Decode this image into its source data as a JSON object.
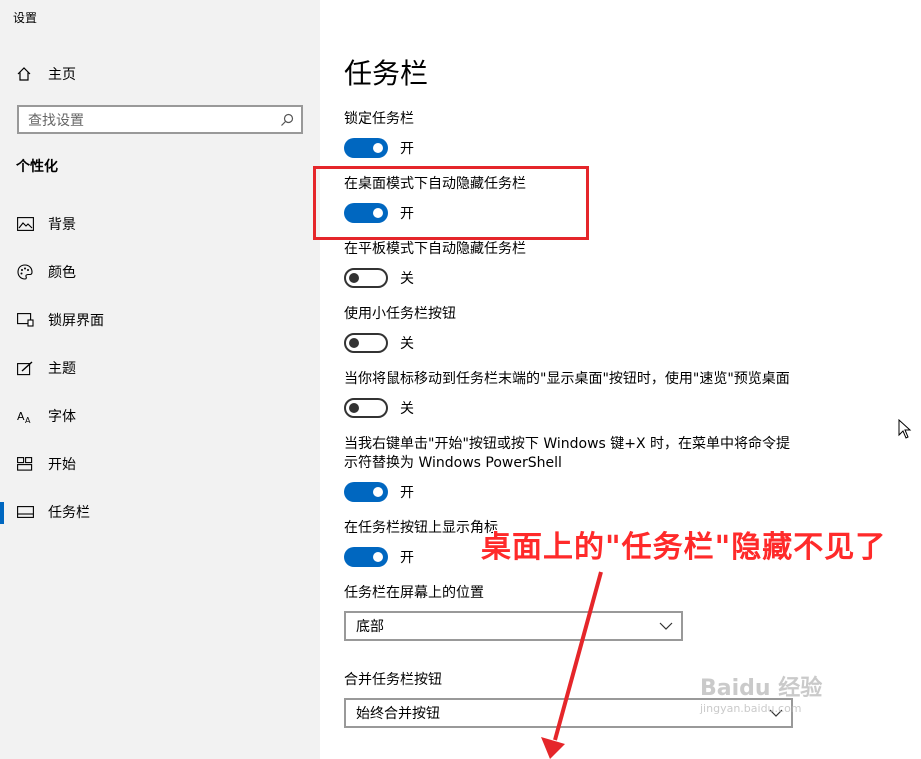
{
  "window": {
    "title": "设置"
  },
  "sidebar": {
    "home": {
      "label": "主页",
      "icon": "home-icon"
    },
    "search": {
      "placeholder": "查找设置",
      "icon": "search-icon"
    },
    "section": "个性化",
    "items": [
      {
        "label": "背景",
        "icon": "image-icon",
        "active": false
      },
      {
        "label": "颜色",
        "icon": "palette-icon",
        "active": false
      },
      {
        "label": "锁屏界面",
        "icon": "lockscreen-icon",
        "active": false
      },
      {
        "label": "主题",
        "icon": "theme-icon",
        "active": false
      },
      {
        "label": "字体",
        "icon": "font-icon",
        "active": false
      },
      {
        "label": "开始",
        "icon": "start-icon",
        "active": false
      },
      {
        "label": "任务栏",
        "icon": "taskbar-icon",
        "active": true
      }
    ]
  },
  "main": {
    "title": "任务栏",
    "settings": [
      {
        "label": "锁定任务栏",
        "state": "开",
        "on": true
      },
      {
        "label": "在桌面模式下自动隐藏任务栏",
        "state": "开",
        "on": true
      },
      {
        "label": "在平板模式下自动隐藏任务栏",
        "state": "关",
        "on": false
      },
      {
        "label": "使用小任务栏按钮",
        "state": "关",
        "on": false
      },
      {
        "label": "当你将鼠标移动到任务栏末端的\"显示桌面\"按钮时，使用\"速览\"预览桌面",
        "state": "关",
        "on": false
      },
      {
        "label_line1": "当我右键单击\"开始\"按钮或按下 Windows 键+X 时，在菜单中将命令提",
        "label_line2": "示符替换为 Windows PowerShell",
        "state": "开",
        "on": true
      },
      {
        "label": "在任务栏按钮上显示角标",
        "state": "开",
        "on": true
      }
    ],
    "position": {
      "label": "任务栏在屏幕上的位置",
      "value": "底部"
    },
    "combine": {
      "label": "合并任务栏按钮",
      "value": "始终合并按钮"
    }
  },
  "annotation": {
    "text": "桌面上的\"任务栏\"隐藏不见了",
    "color": "#ff2a2a"
  },
  "watermark": {
    "text": "Baidu 经验",
    "sub": "jingyan.baidu.com"
  },
  "colors": {
    "accent": "#0067c0",
    "highlight": "#e5262a"
  }
}
